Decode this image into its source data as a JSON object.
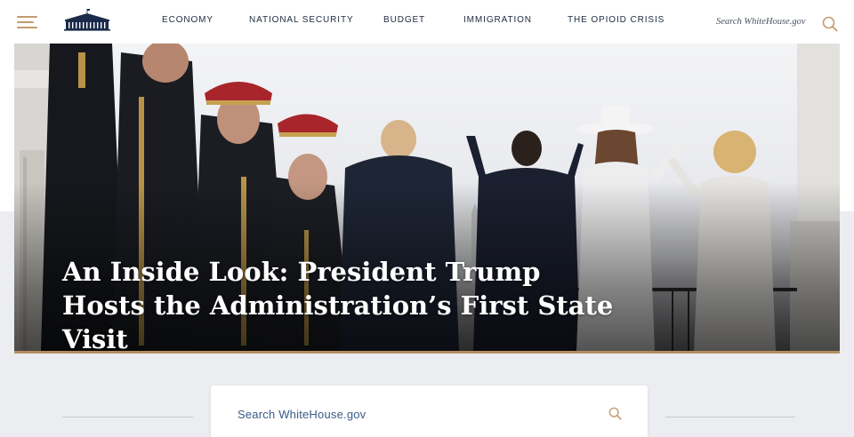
{
  "header": {
    "menu_icon": "hamburger-menu-icon",
    "logo_icon": "white-house-logo",
    "nav": [
      {
        "label": "ECONOMY"
      },
      {
        "label": "NATIONAL SECURITY"
      },
      {
        "label": "BUDGET"
      },
      {
        "label": "IMMIGRATION"
      },
      {
        "label": "THE OPIOID CRISIS"
      }
    ],
    "search_placeholder": "Search WhiteHouse.gov",
    "search_icon": "search-icon"
  },
  "hero": {
    "title": "An Inside Look: President Trump Hosts the Administration’s First State Visit"
  },
  "search_section": {
    "placeholder": "Search WhiteHouse.gov",
    "search_icon": "search-icon"
  },
  "colors": {
    "accent_gold": "#b58c5e",
    "menu_gold": "#c59a6d",
    "nav_text": "#1d2a3e",
    "navy": "#1b2a4a",
    "page_gray": "#ecedf0"
  }
}
